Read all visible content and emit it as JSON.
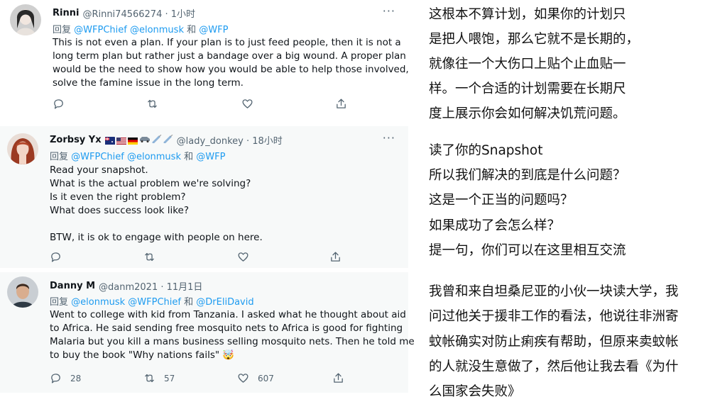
{
  "tweets": [
    {
      "name": "Rinni",
      "handle": "@Rinni74566274 · 1小时",
      "reply_prefix": "回复",
      "reply_mentions": "@WFPChief @elonmusk",
      "reply_and": "和",
      "reply_last": "@WFP",
      "body": [
        "This is not even a plan. If your plan is to just feed people, then it is not a",
        "long term plan but rather just a bandage over a big wound. A proper plan",
        "would be the need to show how you would be able to help those involved,",
        "solve the famine issue in the long term."
      ]
    },
    {
      "name": "Zorbsy Yx",
      "handle": "@lady_donkey · 18小时",
      "flags": [
        "australia-flag",
        "usa-flag",
        "germany-flag",
        "car-emoji",
        "syringe-emoji",
        "syringe-emoji"
      ],
      "reply_prefix": "回复",
      "reply_mentions": "@WFPChief @elonmusk",
      "reply_and": "和",
      "reply_last": "@WFP",
      "body": [
        "Read your snapshot.",
        "What is the actual problem we're solving?",
        "Is it even the right problem?",
        "What does success look like?",
        "",
        "BTW, it is ok to engage with people on here."
      ]
    },
    {
      "name": "Danny M",
      "handle": "@danm2021 · 11月1日",
      "reply_prefix": "回复",
      "reply_mentions": "@elonmusk @WFPChief",
      "reply_and": "和",
      "reply_last": "@DrEliDavid",
      "body": [
        "Went to college with kid from Tanzania. I asked what he thought about aid",
        "to Africa. He said sending free mosquito nets to Africa is good for fighting",
        "Malaria but you kill a mans business selling mosquito nets. Then he told me",
        "to buy the book \"Why nations fails\" 🤯"
      ],
      "counts": {
        "replies": "28",
        "retweets": "57",
        "likes": "607"
      }
    }
  ],
  "translation": [
    "这根本不算计划，如果你的计划只",
    "是把人喂饱，那么它就不是长期的，",
    "就像往一个大伤口上贴个止血贴一",
    "样。一个合适的计划需要在长期尺",
    "度上展示你会如何解决饥荒问题。",
    "读了你的Snapshot",
    "所以我们解决的到底是什么问题？",
    "这是一个正当的问题吗？",
    "如果成功了会怎么样？",
    "提一句，你们可以在这里相互交流",
    "我曾和来自坦桑尼亚的小伙一块读大学，我",
    "问过他关于援非工作的看法，他说往非洲寄",
    "蚊帐确实对防止痢疾有帮助，但原来卖蚊帐",
    "的人就没生意做了，然后他让我去看《为什",
    "么国家会失败》"
  ],
  "colors": {
    "link": "#1d9bf0",
    "muted": "#536471",
    "text": "#0f1419"
  }
}
